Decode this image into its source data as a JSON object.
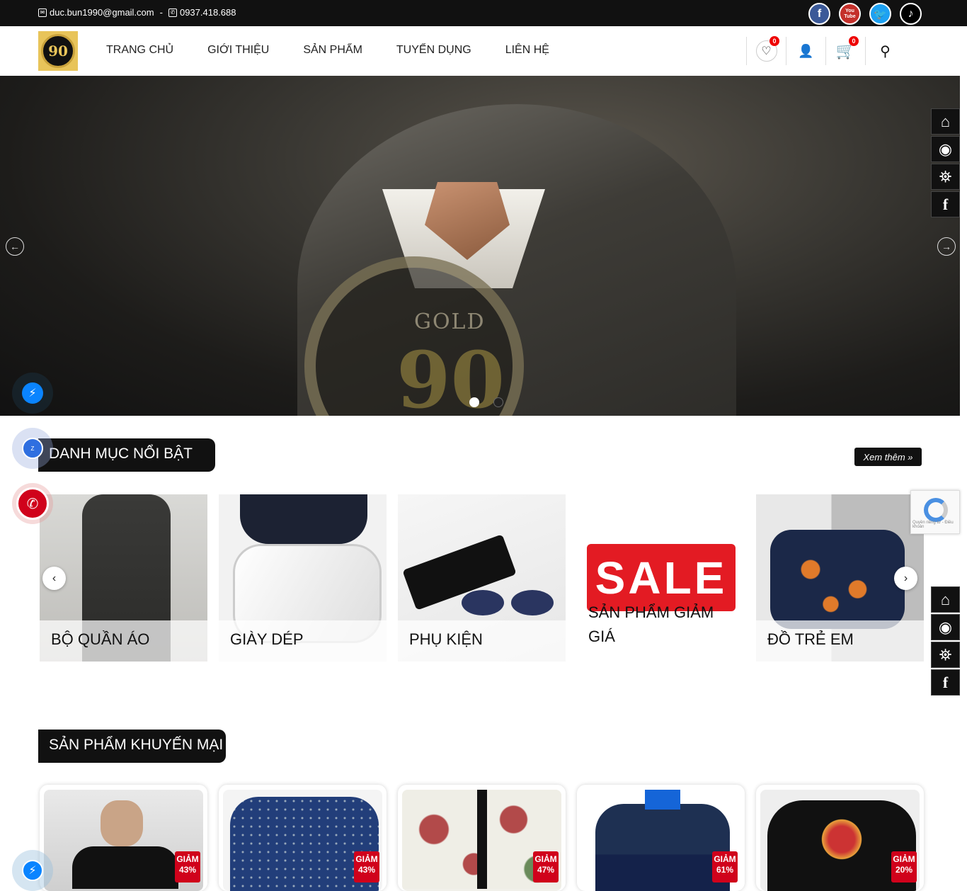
{
  "topbar": {
    "email": "duc.bun1990@gmail.com",
    "separator": "-",
    "phone": "0937.418.688",
    "social": [
      "facebook-icon",
      "youtube-icon",
      "twitter-icon",
      "tiktok-icon"
    ],
    "youtube_text": "You Tube"
  },
  "nav": {
    "logo_text": "90",
    "menu": [
      "TRANG CHỦ",
      "GIỚI THIỆU",
      "SẢN PHẨM",
      "TUYỂN DỤNG",
      "LIÊN HỆ"
    ],
    "wishlist_count": "0",
    "cart_count": "0"
  },
  "hero": {
    "emblem_text": "GOLD",
    "emblem_number": "90",
    "slides": 2,
    "active_slide": 1
  },
  "featured": {
    "title": "DANH MỤC NỔI BẬT",
    "more": "Xem thêm »",
    "categories": [
      {
        "label": "BỘ QUẦN ÁO"
      },
      {
        "label": "GIÀY DÉP"
      },
      {
        "label": "PHỤ KIỆN"
      },
      {
        "label": "SẢN PHẨM GIẢM GIÁ",
        "sale_text": "SALE"
      },
      {
        "label": "ĐỒ TRẺ EM"
      }
    ]
  },
  "promo": {
    "title": "SẢN PHẨM KHUYẾN MẠI",
    "discount_label": "GIẢM",
    "products": [
      {
        "discount": "43%"
      },
      {
        "discount": "43%"
      },
      {
        "discount": "47%"
      },
      {
        "discount": "61%"
      },
      {
        "discount": "20%"
      }
    ]
  },
  "recaptcha": {
    "text": "Quyền riêng tư - Điều khoản"
  },
  "colors": {
    "dark": "#111111",
    "accent_red": "#d0021b",
    "gold": "#e8c45a"
  }
}
